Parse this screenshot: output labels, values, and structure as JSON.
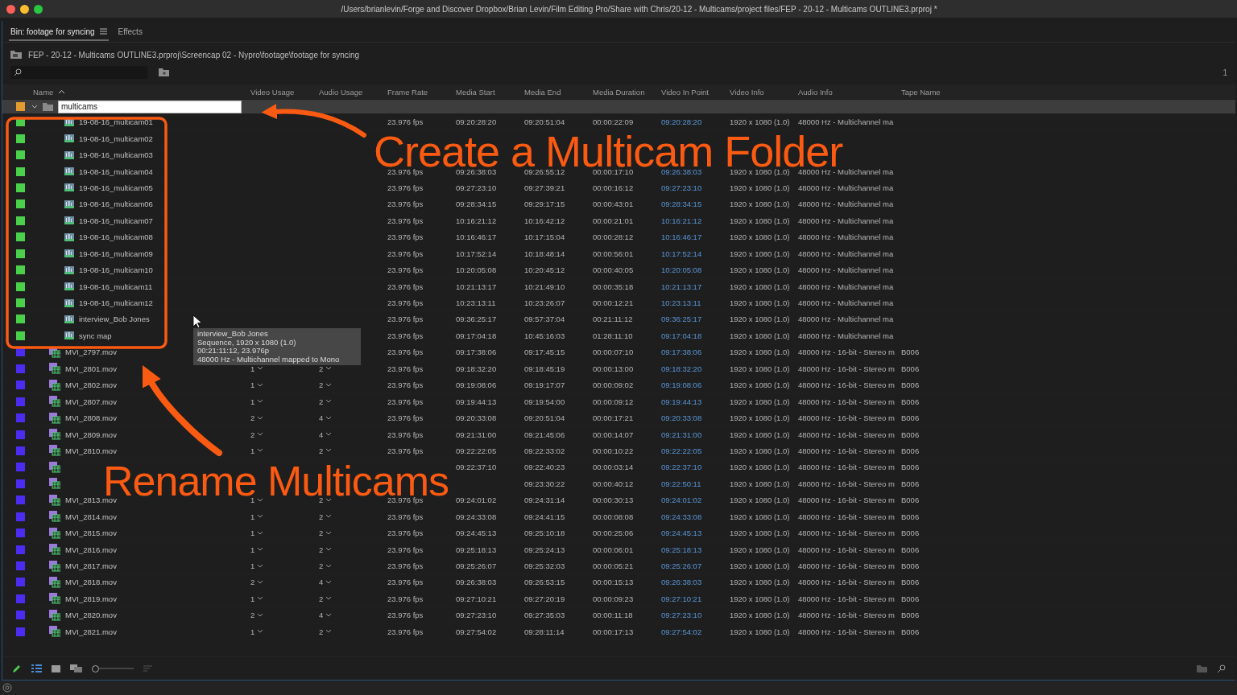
{
  "window": {
    "title": "/Users/brianlevin/Forge and Discover Dropbox/Brian Levin/Film Editing Pro/Share with Chris/20-12 - Multicams/project files/FEP - 20-12 - Multicams OUTLINE3.prproj *"
  },
  "tabs": [
    {
      "label": "Bin: footage for syncing",
      "selected": true
    },
    {
      "label": "Effects",
      "selected": false
    }
  ],
  "breadcrumb": "FEP - 20-12 - Multicams OUTLINE3.prproj\\Screencap 02 - Nypro\\footage\\footage for syncing",
  "item_count": "1",
  "columns": [
    "Name",
    "Video Usage",
    "Audio Usage",
    "Frame Rate",
    "Media Start",
    "Media End",
    "Media Duration",
    "Video In Point",
    "Video Info",
    "Audio Info",
    "Tape Name"
  ],
  "folder": {
    "name": "multicams",
    "kind": "folder",
    "color": "#e39b2f",
    "expanded": true,
    "children": [
      {
        "name": "19-08-16_multicam01",
        "kind": "sequence",
        "color": "#4bd04b",
        "cells": [
          null,
          null,
          "23.976 fps",
          "09:20:28:20",
          "09:20:51:04",
          "00:00:22:09",
          "09:20:28:20",
          "1920 x 1080 (1.0)",
          "48000 Hz - Multichannel ma",
          null
        ]
      },
      {
        "name": "19-08-16_multicam02",
        "kind": "sequence",
        "color": "#4bd04b",
        "cells": [
          null,
          null,
          null,
          null,
          null,
          null,
          null,
          null,
          null,
          null
        ]
      },
      {
        "name": "19-08-16_multicam03",
        "kind": "sequence",
        "color": "#4bd04b",
        "cells": [
          null,
          null,
          null,
          null,
          null,
          null,
          null,
          null,
          null,
          null
        ]
      },
      {
        "name": "19-08-16_multicam04",
        "kind": "sequence",
        "color": "#4bd04b",
        "cells": [
          null,
          null,
          "23.976 fps",
          "09:26:38:03",
          "09:26:55:12",
          "00:00:17:10",
          "09:26:38:03",
          "1920 x 1080 (1.0)",
          "48000 Hz - Multichannel ma",
          null
        ]
      },
      {
        "name": "19-08-16_multicam05",
        "kind": "sequence",
        "color": "#4bd04b",
        "cells": [
          null,
          null,
          "23.976 fps",
          "09:27:23:10",
          "09:27:39:21",
          "00:00:16:12",
          "09:27:23:10",
          "1920 x 1080 (1.0)",
          "48000 Hz - Multichannel ma",
          null
        ]
      },
      {
        "name": "19-08-16_multicam06",
        "kind": "sequence",
        "color": "#4bd04b",
        "cells": [
          null,
          null,
          "23.976 fps",
          "09:28:34:15",
          "09:29:17:15",
          "00:00:43:01",
          "09:28:34:15",
          "1920 x 1080 (1.0)",
          "48000 Hz - Multichannel ma",
          null
        ]
      },
      {
        "name": "19-08-16_multicam07",
        "kind": "sequence",
        "color": "#4bd04b",
        "cells": [
          null,
          null,
          "23.976 fps",
          "10:16:21:12",
          "10:16:42:12",
          "00:00:21:01",
          "10:16:21:12",
          "1920 x 1080 (1.0)",
          "48000 Hz - Multichannel ma",
          null
        ]
      },
      {
        "name": "19-08-16_multicam08",
        "kind": "sequence",
        "color": "#4bd04b",
        "cells": [
          null,
          null,
          "23.976 fps",
          "10:16:46:17",
          "10:17:15:04",
          "00:00:28:12",
          "10:16:46:17",
          "1920 x 1080 (1.0)",
          "48000 Hz - Multichannel ma",
          null
        ]
      },
      {
        "name": "19-08-16_multicam09",
        "kind": "sequence",
        "color": "#4bd04b",
        "cells": [
          null,
          null,
          "23.976 fps",
          "10:17:52:14",
          "10:18:48:14",
          "00:00:56:01",
          "10:17:52:14",
          "1920 x 1080 (1.0)",
          "48000 Hz - Multichannel ma",
          null
        ]
      },
      {
        "name": "19-08-16_multicam10",
        "kind": "sequence",
        "color": "#4bd04b",
        "cells": [
          null,
          null,
          "23.976 fps",
          "10:20:05:08",
          "10:20:45:12",
          "00:00:40:05",
          "10:20:05:08",
          "1920 x 1080 (1.0)",
          "48000 Hz - Multichannel ma",
          null
        ]
      },
      {
        "name": "19-08-16_multicam11",
        "kind": "sequence",
        "color": "#4bd04b",
        "cells": [
          null,
          null,
          "23.976 fps",
          "10:21:13:17",
          "10:21:49:10",
          "00:00:35:18",
          "10:21:13:17",
          "1920 x 1080 (1.0)",
          "48000 Hz - Multichannel ma",
          null
        ]
      },
      {
        "name": "19-08-16_multicam12",
        "kind": "sequence",
        "color": "#4bd04b",
        "cells": [
          null,
          null,
          "23.976 fps",
          "10:23:13:11",
          "10:23:26:07",
          "00:00:12:21",
          "10:23:13:11",
          "1920 x 1080 (1.0)",
          "48000 Hz - Multichannel ma",
          null
        ]
      },
      {
        "name": "interview_Bob Jones",
        "kind": "sequence",
        "color": "#4bd04b",
        "cells": [
          null,
          null,
          "23.976 fps",
          "09:36:25:17",
          "09:57:37:04",
          "00:21:11:12",
          "09:36:25:17",
          "1920 x 1080 (1.0)",
          "48000 Hz - Multichannel ma",
          null
        ]
      },
      {
        "name": "sync map",
        "kind": "sequence",
        "color": "#4bd04b",
        "cells": [
          null,
          null,
          "23.976 fps",
          "09:17:04:18",
          "10:45:16:03",
          "01:28:11:10",
          "09:17:04:18",
          "1920 x 1080 (1.0)",
          "48000 Hz - Multichannel ma",
          null
        ]
      }
    ]
  },
  "rows": [
    {
      "name": "MVI_2797.mov",
      "kind": "clip",
      "color": "#4b2cf0",
      "cells": [
        null,
        null,
        "23.976 fps",
        "09:17:38:06",
        "09:17:45:15",
        "00:00:07:10",
        "09:17:38:06",
        "1920 x 1080 (1.0)",
        "48000 Hz - 16-bit - Stereo m",
        "B006"
      ]
    },
    {
      "name": "MVI_2801.mov",
      "kind": "clip",
      "color": "#4b2cf0",
      "cells": [
        "1",
        "2",
        "23.976 fps",
        "09:18:32:20",
        "09:18:45:19",
        "00:00:13:00",
        "09:18:32:20",
        "1920 x 1080 (1.0)",
        "48000 Hz - 16-bit - Stereo m",
        "B006"
      ]
    },
    {
      "name": "MVI_2802.mov",
      "kind": "clip",
      "color": "#4b2cf0",
      "cells": [
        "1",
        "2",
        "23.976 fps",
        "09:19:08:06",
        "09:19:17:07",
        "00:00:09:02",
        "09:19:08:06",
        "1920 x 1080 (1.0)",
        "48000 Hz - 16-bit - Stereo m",
        "B006"
      ]
    },
    {
      "name": "MVI_2807.mov",
      "kind": "clip",
      "color": "#4b2cf0",
      "cells": [
        "1",
        "2",
        "23.976 fps",
        "09:19:44:13",
        "09:19:54:00",
        "00:00:09:12",
        "09:19:44:13",
        "1920 x 1080 (1.0)",
        "48000 Hz - 16-bit - Stereo m",
        "B006"
      ]
    },
    {
      "name": "MVI_2808.mov",
      "kind": "clip",
      "color": "#4b2cf0",
      "cells": [
        "2",
        "4",
        "23.976 fps",
        "09:20:33:08",
        "09:20:51:04",
        "00:00:17:21",
        "09:20:33:08",
        "1920 x 1080 (1.0)",
        "48000 Hz - 16-bit - Stereo m",
        "B006"
      ]
    },
    {
      "name": "MVI_2809.mov",
      "kind": "clip",
      "color": "#4b2cf0",
      "cells": [
        "2",
        "4",
        "23.976 fps",
        "09:21:31:00",
        "09:21:45:06",
        "00:00:14:07",
        "09:21:31:00",
        "1920 x 1080 (1.0)",
        "48000 Hz - 16-bit - Stereo m",
        "B006"
      ]
    },
    {
      "name": "MVI_2810.mov",
      "kind": "clip",
      "color": "#4b2cf0",
      "cells": [
        "1",
        "2",
        "23.976 fps",
        "09:22:22:05",
        "09:22:33:02",
        "00:00:10:22",
        "09:22:22:05",
        "1920 x 1080 (1.0)",
        "48000 Hz - 16-bit - Stereo m",
        "B006"
      ]
    },
    {
      "name": null,
      "kind": "clip",
      "color": "#4b2cf0",
      "cells": [
        null,
        null,
        null,
        "09:22:37:10",
        "09:22:40:23",
        "00:00:03:14",
        "09:22:37:10",
        "1920 x 1080 (1.0)",
        "48000 Hz - 16-bit - Stereo m",
        "B006"
      ]
    },
    {
      "name": null,
      "kind": "clip",
      "color": "#4b2cf0",
      "cells": [
        null,
        null,
        null,
        null,
        "09:23:30:22",
        "00:00:40:12",
        "09:22:50:11",
        "1920 x 1080 (1.0)",
        "48000 Hz - 16-bit - Stereo m",
        "B006"
      ]
    },
    {
      "name": "MVI_2813.mov",
      "kind": "clip",
      "color": "#4b2cf0",
      "cells": [
        "1",
        "2",
        "23.976 fps",
        "09:24:01:02",
        "09:24:31:14",
        "00:00:30:13",
        "09:24:01:02",
        "1920 x 1080 (1.0)",
        "48000 Hz - 16-bit - Stereo m",
        "B006"
      ]
    },
    {
      "name": "MVI_2814.mov",
      "kind": "clip",
      "color": "#4b2cf0",
      "cells": [
        "1",
        "2",
        "23.976 fps",
        "09:24:33:08",
        "09:24:41:15",
        "00:00:08:08",
        "09:24:33:08",
        "1920 x 1080 (1.0)",
        "48000 Hz - 16-bit - Stereo m",
        "B006"
      ]
    },
    {
      "name": "MVI_2815.mov",
      "kind": "clip",
      "color": "#4b2cf0",
      "cells": [
        "1",
        "2",
        "23.976 fps",
        "09:24:45:13",
        "09:25:10:18",
        "00:00:25:06",
        "09:24:45:13",
        "1920 x 1080 (1.0)",
        "48000 Hz - 16-bit - Stereo m",
        "B006"
      ]
    },
    {
      "name": "MVI_2816.mov",
      "kind": "clip",
      "color": "#4b2cf0",
      "cells": [
        "1",
        "2",
        "23.976 fps",
        "09:25:18:13",
        "09:25:24:13",
        "00:00:06:01",
        "09:25:18:13",
        "1920 x 1080 (1.0)",
        "48000 Hz - 16-bit - Stereo m",
        "B006"
      ]
    },
    {
      "name": "MVI_2817.mov",
      "kind": "clip",
      "color": "#4b2cf0",
      "cells": [
        "1",
        "2",
        "23.976 fps",
        "09:25:26:07",
        "09:25:32:03",
        "00:00:05:21",
        "09:25:26:07",
        "1920 x 1080 (1.0)",
        "48000 Hz - 16-bit - Stereo m",
        "B006"
      ]
    },
    {
      "name": "MVI_2818.mov",
      "kind": "clip",
      "color": "#4b2cf0",
      "cells": [
        "2",
        "4",
        "23.976 fps",
        "09:26:38:03",
        "09:26:53:15",
        "00:00:15:13",
        "09:26:38:03",
        "1920 x 1080 (1.0)",
        "48000 Hz - 16-bit - Stereo m",
        "B006"
      ]
    },
    {
      "name": "MVI_2819.mov",
      "kind": "clip",
      "color": "#4b2cf0",
      "cells": [
        "1",
        "2",
        "23.976 fps",
        "09:27:10:21",
        "09:27:20:19",
        "00:00:09:23",
        "09:27:10:21",
        "1920 x 1080 (1.0)",
        "48000 Hz - 16-bit - Stereo m",
        "B006"
      ]
    },
    {
      "name": "MVI_2820.mov",
      "kind": "clip",
      "color": "#4b2cf0",
      "cells": [
        "2",
        "4",
        "23.976 fps",
        "09:27:23:10",
        "09:27:35:03",
        "00:00:11:18",
        "09:27:23:10",
        "1920 x 1080 (1.0)",
        "48000 Hz - 16-bit - Stereo m",
        "B006"
      ]
    },
    {
      "name": "MVI_2821.mov",
      "kind": "clip",
      "color": "#4b2cf0",
      "cells": [
        "1",
        "2",
        "23.976 fps",
        "09:27:54:02",
        "09:28:11:14",
        "00:00:17:13",
        "09:27:54:02",
        "1920 x 1080 (1.0)",
        "48000 Hz - 16-bit - Stereo m",
        "B006"
      ]
    }
  ],
  "tooltip": {
    "lines": [
      "interview_Bob Jones",
      "Sequence, 1920 x 1080 (1.0)",
      "00:21:11:12, 23.976p",
      "48000 Hz - Multichannel mapped to Mono"
    ]
  },
  "annotations": [
    {
      "text": "Create a Multicam Folder"
    },
    {
      "text": "Rename Multicams"
    }
  ]
}
